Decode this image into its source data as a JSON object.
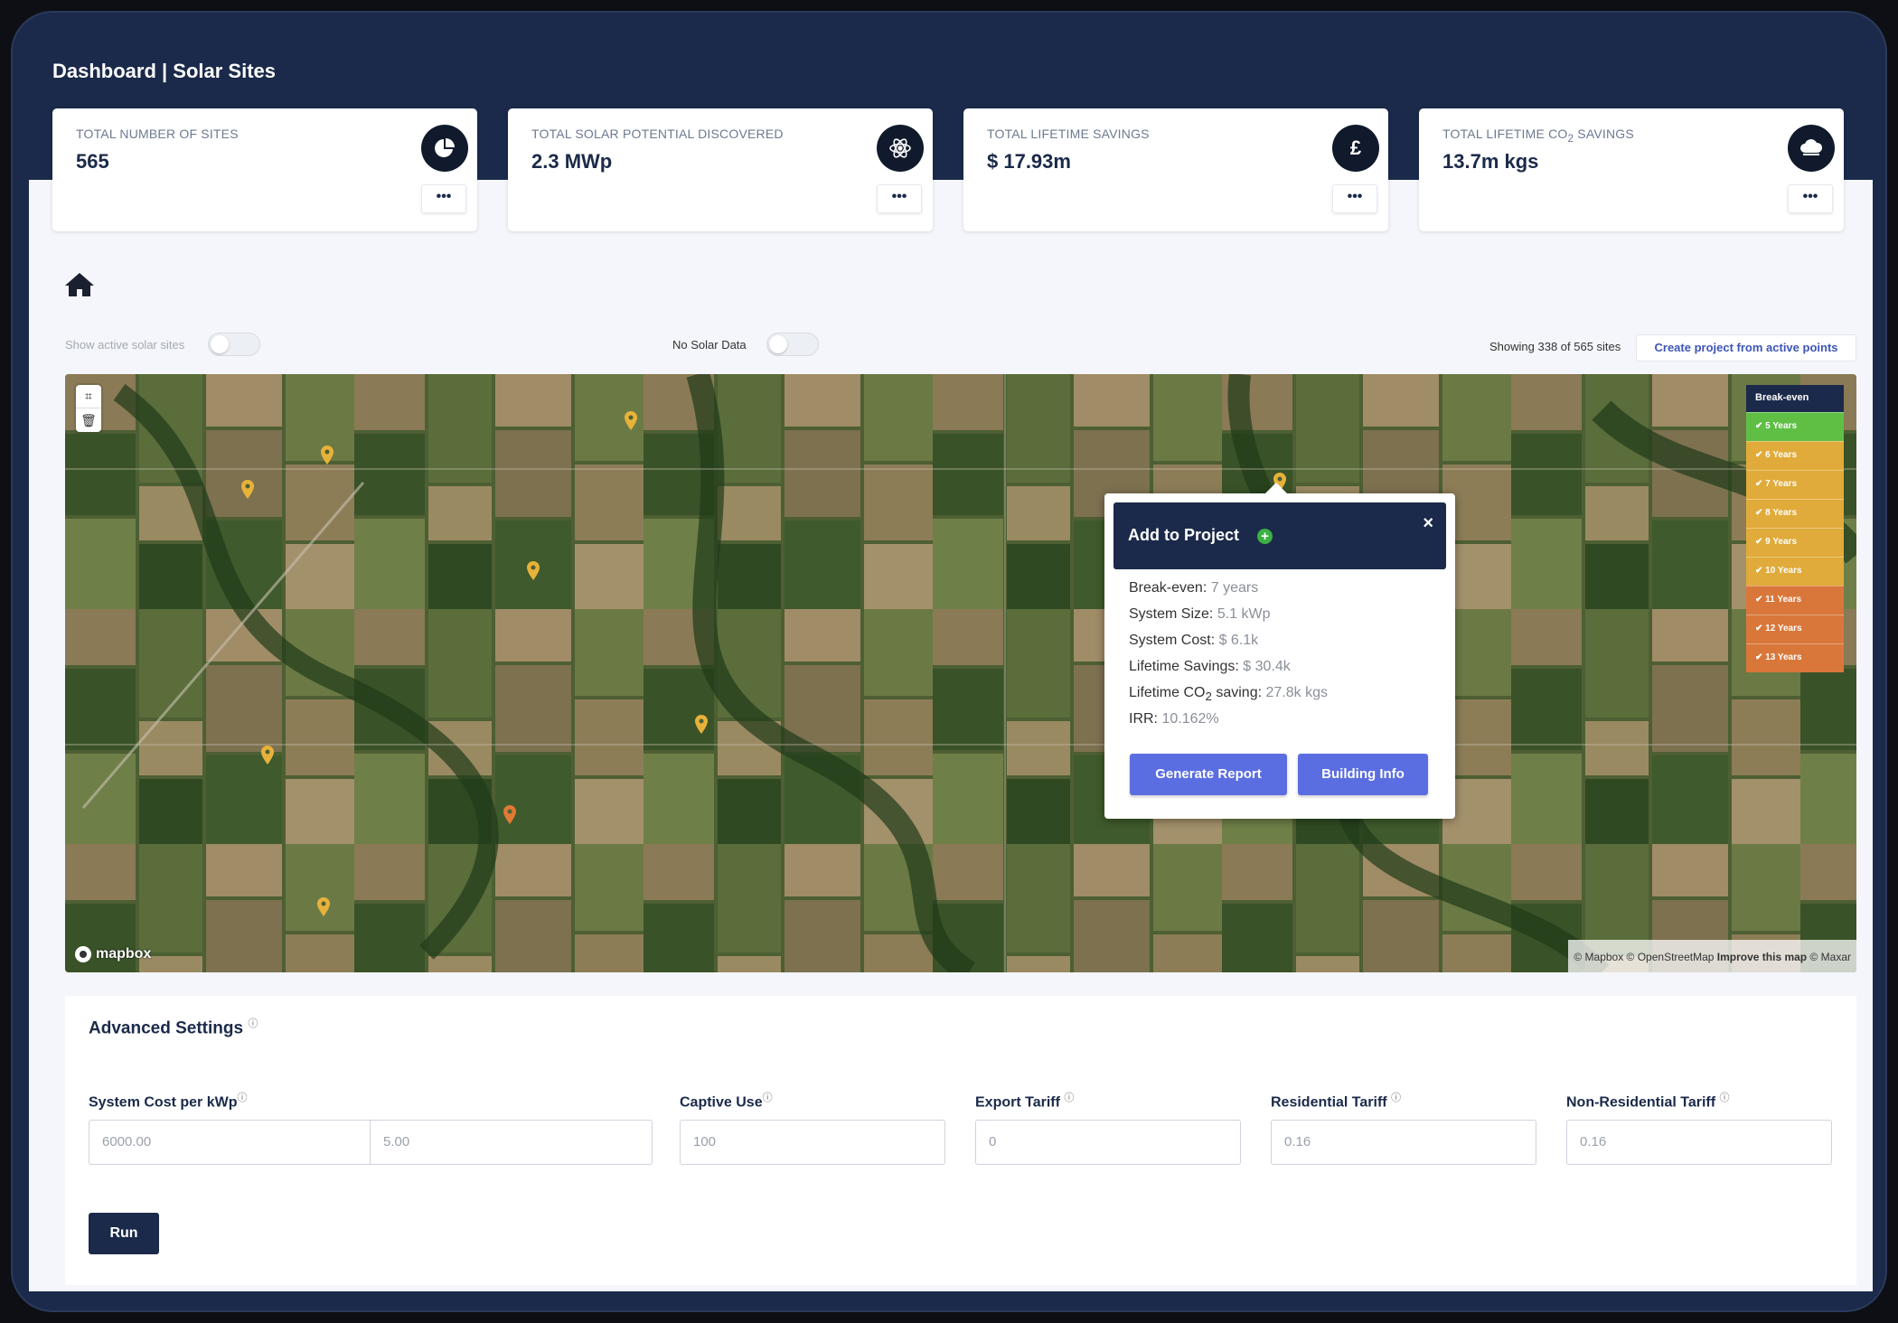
{
  "header": {
    "title": "Dashboard | Solar Sites"
  },
  "stats": [
    {
      "label": "Total Number of Sites",
      "value": "565",
      "icon": "pie-chart-icon",
      "menu": "•••"
    },
    {
      "label": "Total Solar Potential Discovered",
      "value": "2.3 MWp",
      "icon": "atom-icon",
      "menu": "•••"
    },
    {
      "label": "Total Lifetime Savings",
      "value": "$ 17.93m",
      "icon": "pound-icon",
      "icon_text": "£",
      "menu": "•••"
    },
    {
      "label_prefix": "Total Lifetime CO",
      "label_sub": "2",
      "label_suffix": " Savings",
      "value": "13.7m kgs",
      "icon": "cloud-icon",
      "menu": "•••"
    }
  ],
  "controls": {
    "show_active_label": "Show active solar sites",
    "no_solar_label": "No Solar Data",
    "showing_text": "Showing 338 of 565 sites",
    "create_button": "Create project from active points"
  },
  "legend": {
    "title": "Break-even",
    "items": [
      {
        "label": "✔ 5 Years",
        "color": "#5fbf45"
      },
      {
        "label": "✔ 6 Years",
        "color": "#e0ab3a"
      },
      {
        "label": "✔ 7 Years",
        "color": "#e0ab3a"
      },
      {
        "label": "✔ 8 Years",
        "color": "#e0ab3a"
      },
      {
        "label": "✔ 9 Years",
        "color": "#e0ab3a"
      },
      {
        "label": "✔ 10 Years",
        "color": "#e0ab3a"
      },
      {
        "label": "✔ 11 Years",
        "color": "#d9773a"
      },
      {
        "label": "✔ 12 Years",
        "color": "#d9773a"
      },
      {
        "label": "✔ 13 Years",
        "color": "#d9773a"
      }
    ]
  },
  "popup": {
    "title": "Add to Project",
    "close": "×",
    "rows": [
      {
        "label": "Break-even: ",
        "value": "7 years"
      },
      {
        "label": "System Size: ",
        "value": "5.1 kWp"
      },
      {
        "label": "System Cost: ",
        "value": "$ 6.1k"
      },
      {
        "label": "Lifetime Savings: ",
        "value": "$ 30.4k"
      },
      {
        "label": "Lifetime CO",
        "label_sub": "2",
        "label_suffix": " saving: ",
        "value": "27.8k kgs"
      },
      {
        "label": "IRR: ",
        "value": "10.162%"
      }
    ],
    "generate_button": "Generate Report",
    "building_button": "Building Info"
  },
  "map": {
    "logo_text": "mapbox",
    "attribution_1": "© Mapbox © OpenStreetMap ",
    "attribution_improve": "Improve this map",
    "attribution_2": " © Maxar",
    "pin_colors": {
      "yellow": "#e8b23a",
      "orange": "#e07a32"
    }
  },
  "settings": {
    "title": "Advanced Settings",
    "info_mark": "ⓘ",
    "fields": {
      "system_cost_label": "System Cost per kWp",
      "system_cost_value": "6000.00",
      "system_cost_value2": "5.00",
      "captive_label": "Captive Use",
      "captive_value": "100",
      "export_label": "Export Tariff",
      "export_value": "0",
      "residential_label": "Residential Tariff",
      "residential_value": "0.16",
      "nonres_label": "Non-Residential Tariff",
      "nonres_value": "0.16"
    },
    "run_button": "Run"
  }
}
